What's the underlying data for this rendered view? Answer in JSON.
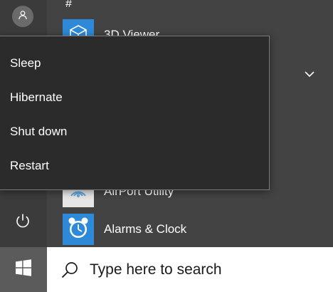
{
  "start_menu": {
    "section_header": "#",
    "apps": [
      {
        "name": "3D Viewer",
        "icon": "3d-viewer-icon",
        "tile_color": "#2e8ad8"
      },
      {
        "name": "AirPort Utility",
        "icon": "airport-utility-icon",
        "tile_color": "#e6e6e6"
      },
      {
        "name": "Alarms & Clock",
        "icon": "alarm-clock-icon",
        "tile_color": "#2e8ad8"
      }
    ],
    "user_icon": "user-avatar-icon",
    "power_icon": "power-icon",
    "expand_icon": "chevron-down-icon"
  },
  "power_menu": {
    "items": [
      {
        "label": "Sleep"
      },
      {
        "label": "Hibernate"
      },
      {
        "label": "Shut down"
      },
      {
        "label": "Restart"
      }
    ]
  },
  "taskbar": {
    "start_icon": "windows-logo-icon",
    "search": {
      "icon": "search-icon",
      "placeholder": "Type here to search"
    }
  },
  "colors": {
    "start_bg": "#434343",
    "menu_bg": "#2b2b2b",
    "menu_border": "#7a7a7a",
    "accent_tile": "#2e8ad8",
    "taskbar_bg": "#ffffff"
  }
}
